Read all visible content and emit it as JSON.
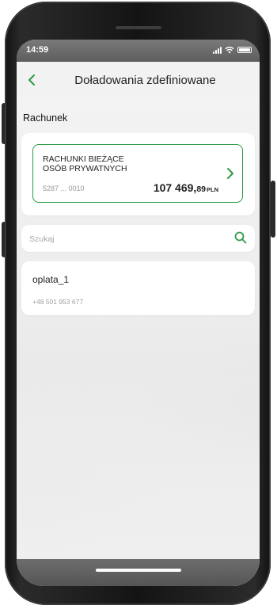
{
  "status_bar": {
    "time": "14:59",
    "icons": [
      "signal-icon",
      "wifi-icon",
      "battery-icon"
    ]
  },
  "header": {
    "back_icon": "chevron-left-icon",
    "title": "Doładowania zdefiniowane"
  },
  "account_section": {
    "label": "Rachunek",
    "account": {
      "name_line1": "RACHUNKI BIEŻĄCE",
      "name_line2": "OSÓB PRYWATNYCH",
      "number": "5287 ... 0010",
      "balance_main": "107 469,",
      "balance_decimal": "89",
      "currency": "PLN",
      "action_icon": "chevron-right-icon"
    }
  },
  "search": {
    "placeholder": "Szukaj",
    "value": "",
    "icon": "search-icon"
  },
  "items": [
    {
      "name": "oplata_1",
      "phone": "+48 501 953 677"
    }
  ],
  "colors": {
    "accent": "#2d9a46",
    "background": "#f2f2f2",
    "card": "#ffffff"
  }
}
